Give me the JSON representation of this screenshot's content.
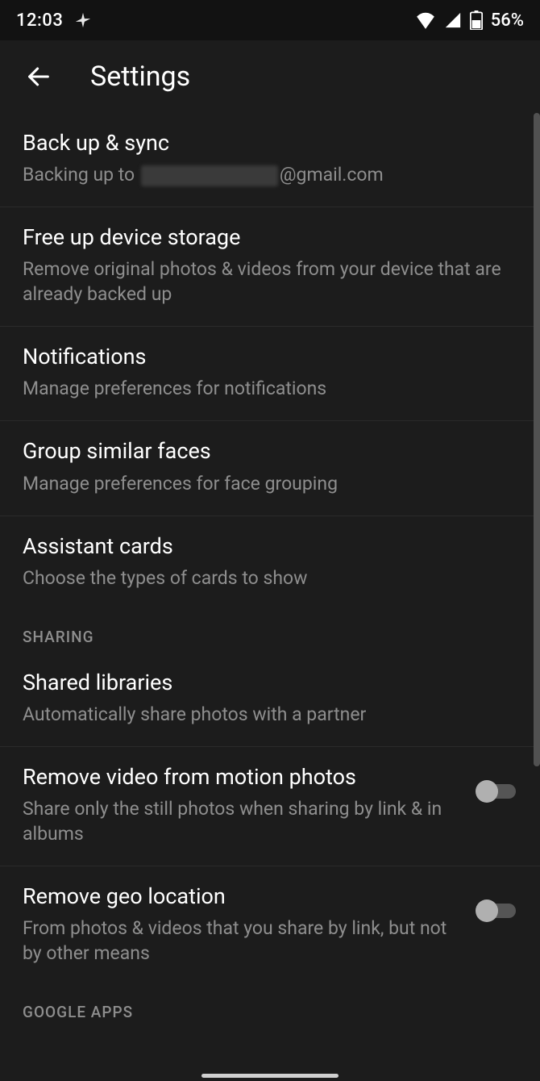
{
  "status_bar": {
    "time": "12:03",
    "battery": "56%"
  },
  "header": {
    "title": "Settings"
  },
  "items": {
    "backup": {
      "title": "Back up & sync",
      "subtitle_prefix": "Backing up to ",
      "subtitle_suffix": "@gmail.com"
    },
    "free_storage": {
      "title": "Free up device storage",
      "subtitle": "Remove original photos & videos from your device that are already backed up"
    },
    "notifications": {
      "title": "Notifications",
      "subtitle": "Manage preferences for notifications"
    },
    "faces": {
      "title": "Group similar faces",
      "subtitle": "Manage preferences for face grouping"
    },
    "assistant": {
      "title": "Assistant cards",
      "subtitle": "Choose the types of cards to show"
    },
    "shared_libs": {
      "title": "Shared libraries",
      "subtitle": "Automatically share photos with a partner"
    },
    "remove_video": {
      "title": "Remove video from motion photos",
      "subtitle": "Share only the still photos when sharing by link & in albums"
    },
    "remove_geo": {
      "title": "Remove geo location",
      "subtitle": "From photos & videos that you share by link, but not by other means"
    }
  },
  "sections": {
    "sharing": "SHARING",
    "google_apps": "GOOGLE APPS"
  },
  "toggles": {
    "remove_video": false,
    "remove_geo": false
  }
}
